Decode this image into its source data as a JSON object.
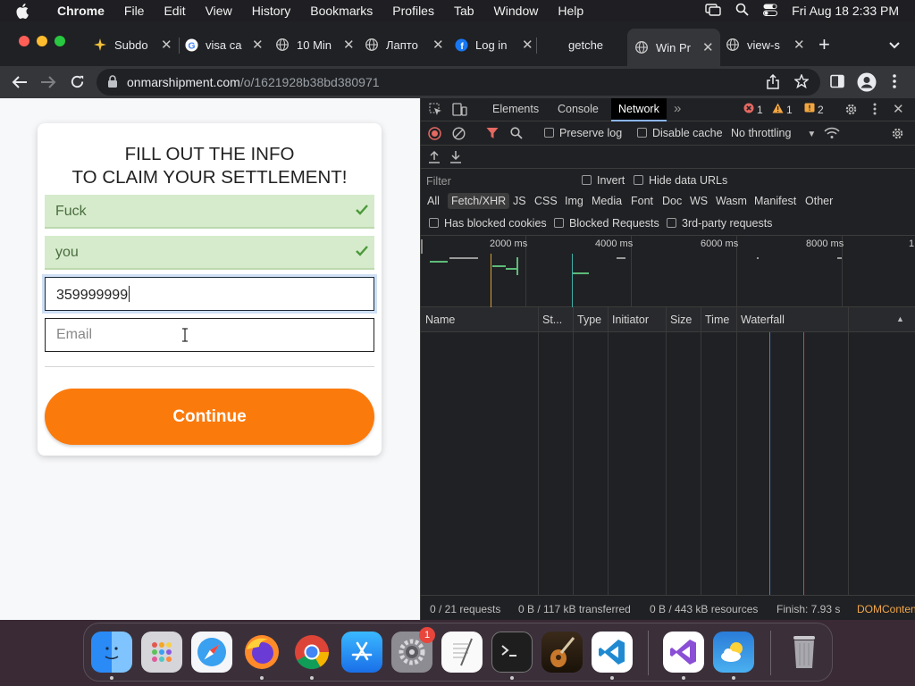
{
  "menubar": {
    "app_name": "Chrome",
    "items": [
      "File",
      "Edit",
      "View",
      "History",
      "Bookmarks",
      "Profiles",
      "Tab",
      "Window",
      "Help"
    ],
    "clock": "Fri Aug 18  2:33 PM"
  },
  "tabs": [
    {
      "title": "Subdo",
      "icon": "subdo-favicon"
    },
    {
      "title": "visa ca",
      "icon": "google-icon"
    },
    {
      "title": "10 Min",
      "icon": "globe-icon"
    },
    {
      "title": "Лапто",
      "icon": "globe-icon"
    },
    {
      "title": "Log in",
      "icon": "facebook-icon"
    },
    {
      "title": "getche",
      "icon": "blank"
    },
    {
      "title": "Win Pr",
      "icon": "globe-icon",
      "active": true
    },
    {
      "title": "view-s",
      "icon": "globe-icon"
    }
  ],
  "address": {
    "host": "onmarshipment.com",
    "path": "/o/1621928b38bd380971"
  },
  "form": {
    "heading_line1": "FILL OUT THE INFO",
    "heading_line2": "TO CLAIM YOUR SETTLEMENT!",
    "first_name": "Fuck",
    "last_name": "you",
    "phone": "359999999",
    "email_placeholder": "Email",
    "continue_label": "Continue"
  },
  "devtools": {
    "tabs": [
      "Elements",
      "Console",
      "Network"
    ],
    "active_tab": "Network",
    "errors": "1",
    "warnings": "1",
    "issues": "2",
    "preserve_log": "Preserve log",
    "disable_cache": "Disable cache",
    "throttling": "No throttling",
    "filter_placeholder": "Filter",
    "invert": "Invert",
    "hide_data_urls": "Hide data URLs",
    "types": [
      "All",
      "Fetch/XHR",
      "JS",
      "CSS",
      "Img",
      "Media",
      "Font",
      "Doc",
      "WS",
      "Wasm",
      "Manifest",
      "Other"
    ],
    "has_blocked_cookies": "Has blocked cookies",
    "blocked_requests": "Blocked Requests",
    "third_party": "3rd-party requests",
    "timeline_labels": [
      "2000 ms",
      "4000 ms",
      "6000 ms",
      "8000 ms",
      "1"
    ],
    "columns": [
      "Name",
      "St...",
      "Type",
      "Initiator",
      "Size",
      "Time",
      "Waterfall"
    ],
    "status_requests": "0 / 21 requests",
    "status_transferred": "0 B / 117 kB transferred",
    "status_resources": "0 B / 443 kB resources",
    "status_finish": "Finish: 7.93 s",
    "status_domcontent": "DOMConten"
  },
  "dock": {
    "apps": [
      "finder",
      "launchpad",
      "safari",
      "firefox",
      "chrome",
      "app-store",
      "system-preferences",
      "textedit",
      "terminal",
      "garageband",
      "vscode",
      "visual-studio",
      "weather",
      "trash"
    ],
    "system_preferences_badge": "1"
  },
  "colors": {
    "cta": "#fb7a0c",
    "valid_bg": "#d6ebcc",
    "valid_check": "#4a9a3a"
  }
}
